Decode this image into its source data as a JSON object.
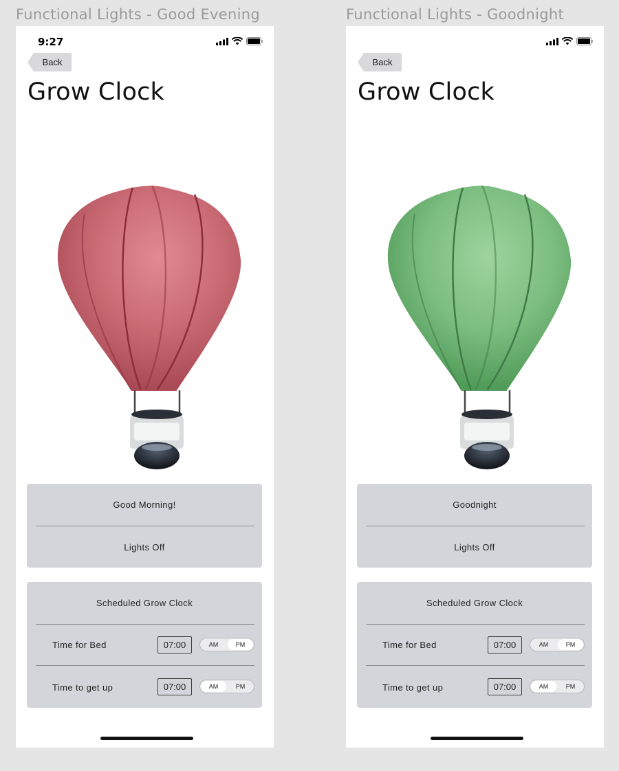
{
  "frames": [
    {
      "title": "Functional Lights - Good Evening",
      "status_time": "9:27",
      "back_label": "Back",
      "app_title": "Grow Clock",
      "balloon_color": "#c96a73",
      "status_card": {
        "greeting": "Good Morning!",
        "lights": "Lights Off"
      },
      "schedule": {
        "header": "Scheduled Grow Clock",
        "rows": [
          {
            "label": "Time for Bed",
            "time": "07:00",
            "am": "AM",
            "pm": "PM",
            "selected": "PM"
          },
          {
            "label": "Time to get up",
            "time": "07:00",
            "am": "AM",
            "pm": "PM",
            "selected": "AM"
          }
        ]
      }
    },
    {
      "title": "Functional Lights - Goodnight",
      "status_time": "",
      "back_label": "Back",
      "app_title": "Grow Clock",
      "balloon_color": "#7cbd80",
      "status_card": {
        "greeting": "Goodnight",
        "lights": "Lights Off"
      },
      "schedule": {
        "header": "Scheduled Grow Clock",
        "rows": [
          {
            "label": "Time for Bed",
            "time": "07:00",
            "am": "AM",
            "pm": "PM",
            "selected": "PM"
          },
          {
            "label": "Time to get up",
            "time": "07:00",
            "am": "AM",
            "pm": "PM",
            "selected": "AM"
          }
        ]
      }
    }
  ]
}
